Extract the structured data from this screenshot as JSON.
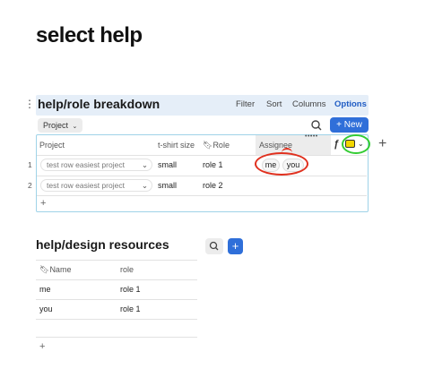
{
  "page": {
    "title": "select help"
  },
  "db1": {
    "title": "help/role breakdown",
    "header_buttons": [
      "Filter",
      "Sort",
      "Columns",
      "Options"
    ],
    "filter_pill": "Project",
    "new_label": "New",
    "columns": [
      "Project",
      "t-shirt size",
      "Role",
      "Assignee"
    ],
    "rows": [
      {
        "num": "1",
        "project": "test row easiest project",
        "size": "small",
        "role": "role 1",
        "assignees": [
          "me",
          "you"
        ]
      },
      {
        "num": "2",
        "project": "test row easiest project",
        "size": "small",
        "role": "role 2",
        "assignees": []
      }
    ],
    "add_row": "+",
    "add_column": "+"
  },
  "db2": {
    "title": "help/design resources",
    "columns": [
      "Name",
      "role"
    ],
    "rows": [
      {
        "name": "me",
        "role": "role 1"
      },
      {
        "name": "you",
        "role": "role 1"
      }
    ],
    "add_row": "+"
  },
  "annotations": {
    "highlight_red": "#e0301e",
    "highlight_green": "#33cc33"
  }
}
